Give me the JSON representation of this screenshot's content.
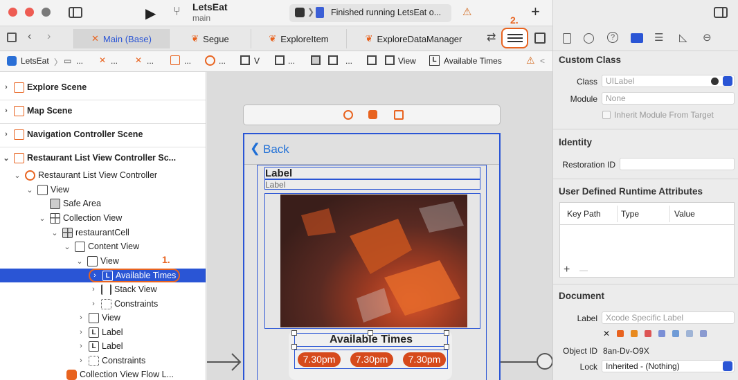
{
  "toolbar": {
    "project": "LetsEat",
    "branch": "main",
    "status": "Finished running LetsEat o..."
  },
  "tabs": [
    {
      "label": "Main (Base)",
      "active": true
    },
    {
      "label": "Segue"
    },
    {
      "label": "ExploreItem"
    },
    {
      "label": "ExploreDataManager"
    }
  ],
  "jumpbar": {
    "root": "LetsEat",
    "view": "V",
    "view2": "View",
    "current": "Available Times",
    "ellipsis": "..."
  },
  "outline": {
    "sections": [
      "Explore Scene",
      "Map Scene",
      "Navigation Controller Scene",
      "Restaurant List View Controller Sc..."
    ],
    "items": [
      "Restaurant List View Controller",
      "View",
      "Safe Area",
      "Collection View",
      "restaurantCell",
      "Content View",
      "View",
      "Available Times",
      "Stack View",
      "Constraints",
      "View",
      "Label",
      "Label",
      "Constraints",
      "Collection View Flow L..."
    ]
  },
  "annotations": {
    "one": "1.",
    "two": "2."
  },
  "canvas": {
    "back": "Back",
    "label_bold": "Label",
    "label_small": "Label",
    "available_times": "Available Times",
    "times": [
      "7.30pm",
      "7.30pm",
      "7.30pm"
    ]
  },
  "inspector": {
    "custom_class": "Custom Class",
    "class_label": "Class",
    "class_placeholder": "UILabel",
    "module_label": "Module",
    "module_value": "None",
    "inherit_label": "Inherit Module From Target",
    "identity": "Identity",
    "restoration_label": "Restoration ID",
    "udra": "User Defined Runtime Attributes",
    "col_keypath": "Key Path",
    "col_type": "Type",
    "col_value": "Value",
    "add": "+",
    "remove": "—",
    "document": "Document",
    "doc_label": "Label",
    "doc_label_placeholder": "Xcode Specific Label",
    "object_id_label": "Object ID",
    "object_id": "8an-Dv-O9X",
    "lock_label": "Lock",
    "lock_value": "Inherited - (Nothing)",
    "x": "✕"
  },
  "colors": {
    "accent": "#e8631f",
    "selection": "#2a55d5",
    "blue": "#1f6fd6"
  }
}
